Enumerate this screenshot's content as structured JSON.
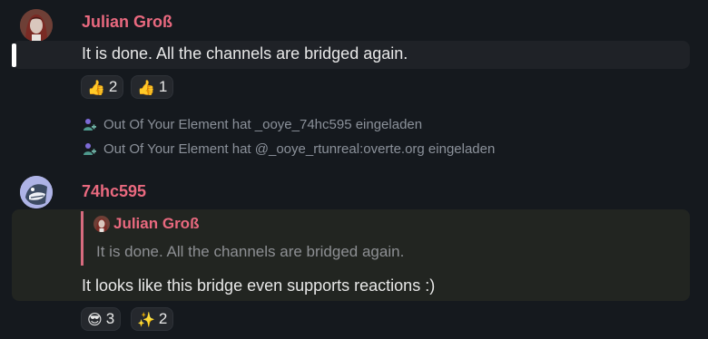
{
  "messages": [
    {
      "sender": "Julian Groß",
      "text": "It is done. All the channels are bridged again.",
      "reactions": [
        {
          "emoji": "👍",
          "count": "2"
        },
        {
          "emoji": "👍",
          "count": "1"
        }
      ]
    },
    {
      "sender": "74hc595",
      "reply": {
        "sender": "Julian Groß",
        "text": "It is done. All the channels are bridged again."
      },
      "text": "It looks like this bridge even supports reactions :)",
      "reactions": [
        {
          "emoji": "😎",
          "count": "3"
        },
        {
          "emoji": "✨",
          "count": "2"
        }
      ]
    }
  ],
  "events": [
    {
      "text": "Out Of Your Element hat _ooye_74hc595 eingeladen"
    },
    {
      "text": "Out Of Your Element hat @_ooye_rtunreal:overte.org eingeladen"
    }
  ],
  "colors": {
    "background": "#15191e",
    "sender": "#e9697f",
    "event_text": "#8b919a"
  }
}
